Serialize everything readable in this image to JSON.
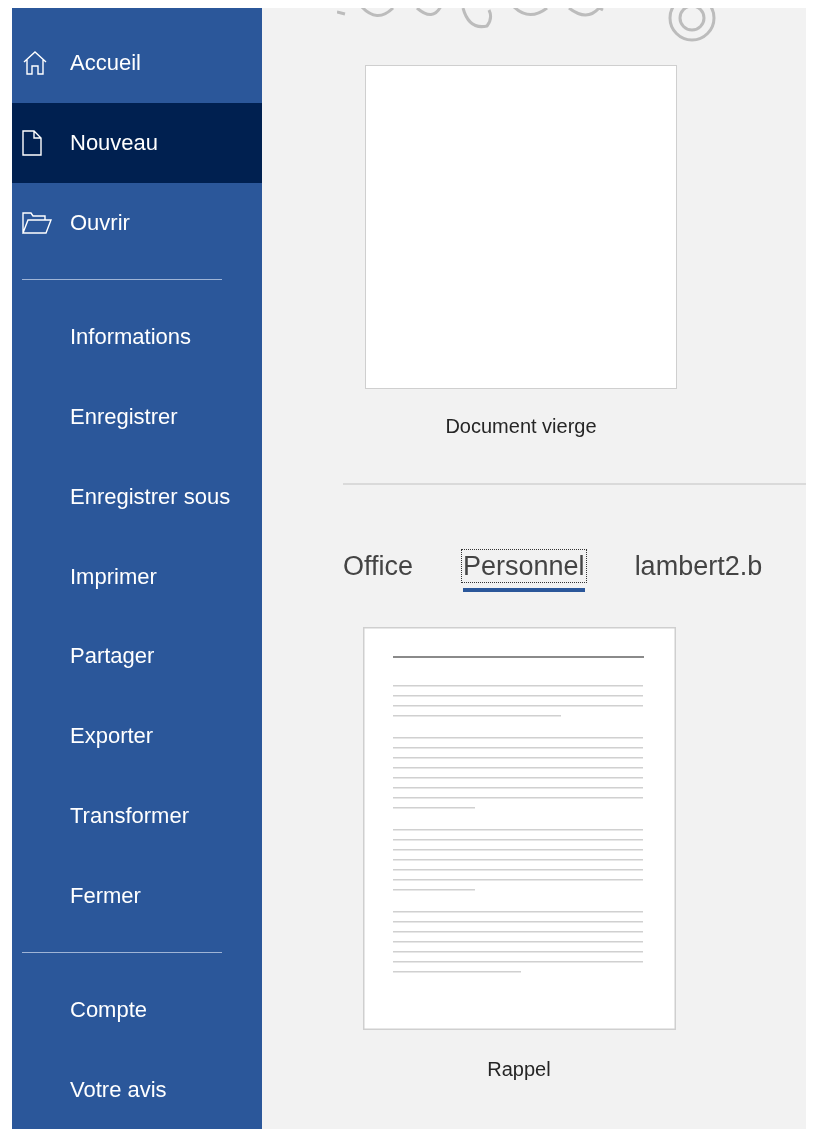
{
  "sidebar": {
    "groups": [
      [
        {
          "label": "Accueil",
          "selected": false
        },
        {
          "label": "Nouveau",
          "selected": true
        },
        {
          "label": "Ouvrir",
          "selected": false
        }
      ],
      [
        {
          "label": "Informations",
          "selected": false
        },
        {
          "label": "Enregistrer",
          "selected": false
        },
        {
          "label": "Enregistrer sous",
          "selected": false
        },
        {
          "label": "Imprimer",
          "selected": false
        },
        {
          "label": "Partager",
          "selected": false
        },
        {
          "label": "Exporter",
          "selected": false
        },
        {
          "label": "Transformer",
          "selected": false
        },
        {
          "label": "Fermer",
          "selected": false
        }
      ],
      [
        {
          "label": "Compte",
          "selected": false
        },
        {
          "label": "Votre avis",
          "selected": false
        }
      ]
    ]
  },
  "blank_template": {
    "label": "Document vierge"
  },
  "tabs": [
    {
      "label": "Office",
      "selected": false
    },
    {
      "label": "Personnel",
      "selected": true
    },
    {
      "label": "lambert2.b",
      "selected": false
    }
  ],
  "templates": [
    {
      "label": "Rappel"
    }
  ]
}
